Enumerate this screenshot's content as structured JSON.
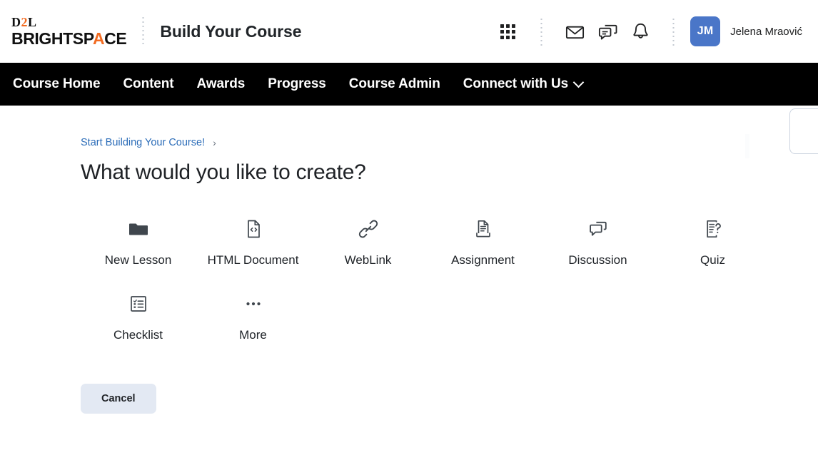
{
  "header": {
    "logo": {
      "top_text": "D2L",
      "top_accent_char": "2",
      "bottom_text": "BRIGHTSPACE",
      "accent_color": "#f26b21"
    },
    "title": "Build Your Course",
    "icons": [
      {
        "name": "waffle-menu-icon",
        "label": "Course Selector"
      },
      {
        "name": "envelope-icon",
        "label": "Email"
      },
      {
        "name": "chat-bubbles-icon",
        "label": "Subscriptions"
      },
      {
        "name": "bell-icon",
        "label": "Notifications"
      }
    ],
    "user": {
      "initials": "JM",
      "name": "Jelena Mraović",
      "avatar_color": "#4a76c8"
    }
  },
  "nav": {
    "items": [
      {
        "label": "Course Home",
        "has_chevron": false
      },
      {
        "label": "Content",
        "has_chevron": false
      },
      {
        "label": "Awards",
        "has_chevron": false
      },
      {
        "label": "Progress",
        "has_chevron": false
      },
      {
        "label": "Course Admin",
        "has_chevron": false
      },
      {
        "label": "Connect with Us",
        "has_chevron": true
      }
    ],
    "background": "#000000"
  },
  "main": {
    "breadcrumb": {
      "label": "Start Building Your Course!",
      "separator": "›",
      "color": "#2b6cb8"
    },
    "heading": "What would you like to create?",
    "options": [
      {
        "label": "New Lesson",
        "icon": "folder-icon"
      },
      {
        "label": "HTML Document",
        "icon": "html-document-icon"
      },
      {
        "label": "WebLink",
        "icon": "link-icon"
      },
      {
        "label": "Assignment",
        "icon": "assignment-icon"
      },
      {
        "label": "Discussion",
        "icon": "discussion-icon"
      },
      {
        "label": "Quiz",
        "icon": "quiz-icon"
      },
      {
        "label": "Checklist",
        "icon": "checklist-icon"
      },
      {
        "label": "More",
        "icon": "more-dots-icon"
      }
    ],
    "cancel_label": "Cancel",
    "cancel_color": "#e3e9f3"
  }
}
